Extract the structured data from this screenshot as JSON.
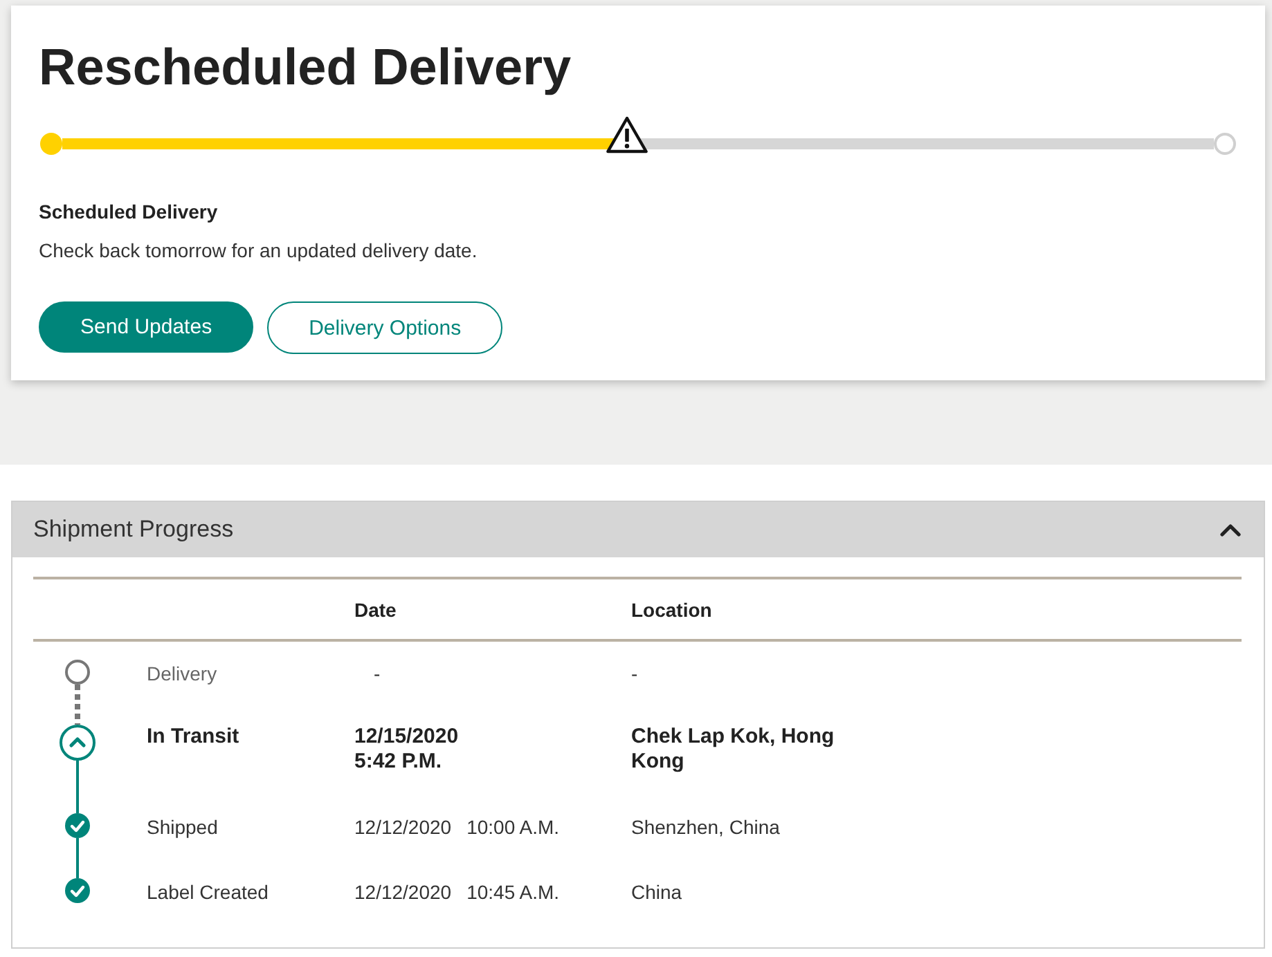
{
  "delivery_card": {
    "title": "Rescheduled Delivery",
    "progress": {
      "level": 0.49
    },
    "status_heading": "Scheduled Delivery",
    "status_message": "Check back tomorrow for an updated delivery date.",
    "buttons": [
      {
        "label": "Send Updates",
        "kind": "primary"
      },
      {
        "label": "Delivery Options",
        "kind": "secondary"
      }
    ]
  },
  "shipment_progress": {
    "title": "Shipment Progress",
    "expanded": true,
    "columns": [
      "Date",
      "Location"
    ],
    "events": [
      {
        "status": "Delivery",
        "kind": "pending",
        "date": "-",
        "location": "-"
      },
      {
        "status": "In Transit",
        "kind": "current",
        "date": "12/15/2020",
        "time": "5:42 P.M.",
        "location": "Chek Lap Kok, Hong Kong"
      },
      {
        "status": "Shipped",
        "kind": "done",
        "date": "12/12/2020",
        "time": "10:00 A.M.",
        "location": "Shenzhen, China"
      },
      {
        "status": "Label Created",
        "kind": "done",
        "date": "12/12/2020",
        "time": "10:45 A.M.",
        "location": "China"
      }
    ]
  }
}
